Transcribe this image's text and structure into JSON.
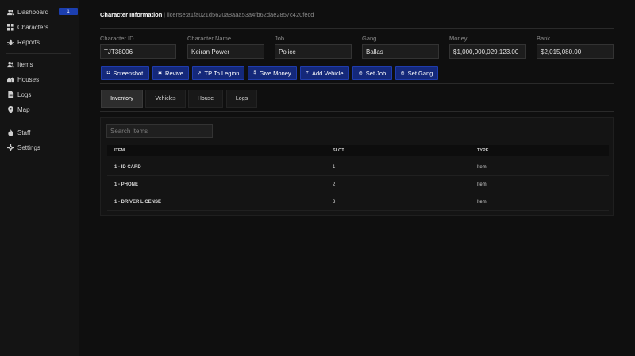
{
  "sidebar": {
    "items": [
      {
        "label": "Dashboard",
        "icon": "users-icon",
        "badge": "1"
      },
      {
        "label": "Characters",
        "icon": "grid-icon"
      },
      {
        "label": "Reports",
        "icon": "bug-icon"
      },
      {
        "label": "Items",
        "icon": "users-icon"
      },
      {
        "label": "Houses",
        "icon": "houses-icon"
      },
      {
        "label": "Logs",
        "icon": "file-icon"
      },
      {
        "label": "Map",
        "icon": "pin-icon"
      },
      {
        "label": "Staff",
        "icon": "flame-icon"
      },
      {
        "label": "Settings",
        "icon": "cog-icon"
      }
    ]
  },
  "header": {
    "title": "Character Information",
    "divider": "|",
    "license": "license:a1fa021d5620a8aaa53a4fb62dae2857c420fecd"
  },
  "fields": [
    {
      "label": "Character ID",
      "value": "TJT38006"
    },
    {
      "label": "Character Name",
      "value": "Keiran Power"
    },
    {
      "label": "Job",
      "value": "Police"
    },
    {
      "label": "Gang",
      "value": "Ballas"
    },
    {
      "label": "Money",
      "value": "$1,000,000,029,123.00"
    },
    {
      "label": "Bank",
      "value": "$2,015,080.00"
    }
  ],
  "actions": [
    {
      "label": "Screenshot",
      "icon": "camera-icon",
      "glyph": "◘"
    },
    {
      "label": "Revive",
      "icon": "star-icon",
      "glyph": "✱"
    },
    {
      "label": "TP To Legion",
      "icon": "pin-icon",
      "glyph": "↗"
    },
    {
      "label": "Give Money",
      "icon": "dollar-icon",
      "glyph": "$"
    },
    {
      "label": "Add Vehicle",
      "icon": "plus-icon",
      "glyph": "+"
    },
    {
      "label": "Set Job",
      "icon": "tag-icon",
      "glyph": "⊘"
    },
    {
      "label": "Set Gang",
      "icon": "tag-icon",
      "glyph": "⊘"
    }
  ],
  "tabs": [
    {
      "label": "Inventory",
      "active": true
    },
    {
      "label": "Vehicles"
    },
    {
      "label": "House"
    },
    {
      "label": "Logs"
    }
  ],
  "inventory": {
    "search_placeholder": "Search Items",
    "columns": [
      "ITEM",
      "SLOT",
      "TYPE"
    ],
    "rows": [
      {
        "item": "1 - ID CARD",
        "slot": "1",
        "type": "Item"
      },
      {
        "item": "1 - PHONE",
        "slot": "2",
        "type": "Item"
      },
      {
        "item": "1 - DRIVER LICENSE",
        "slot": "3",
        "type": "Item"
      }
    ]
  },
  "colors": {
    "accent": "#14287a",
    "badge": "#1c3fb0",
    "background": "#0f0f0f"
  }
}
